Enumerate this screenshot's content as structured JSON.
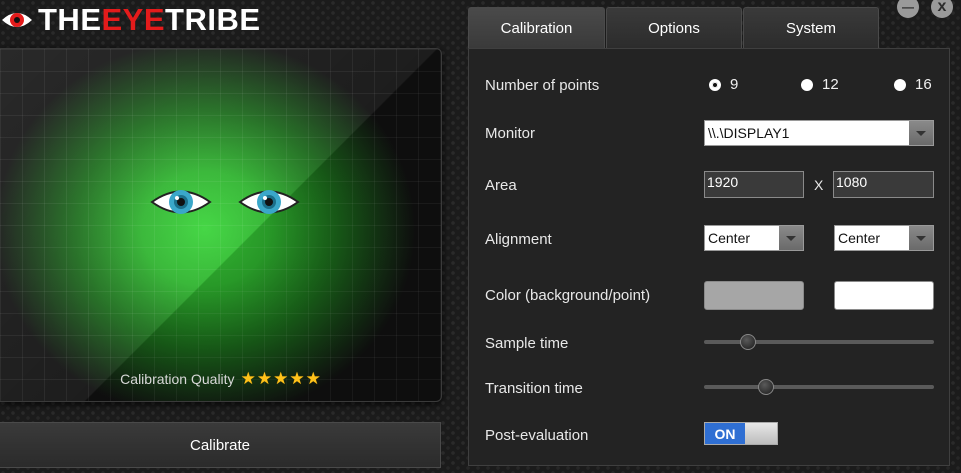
{
  "logo": {
    "text_white_1": "THE",
    "text_red": "EYE",
    "text_white_2": "TRIBE"
  },
  "window_controls": {
    "minimize": "—",
    "close": "x"
  },
  "preview": {
    "quality_label": "Calibration Quality",
    "quality_stars": 5,
    "star_glyph": "★"
  },
  "calibrate_button": "Calibrate",
  "tabs": [
    {
      "label": "Calibration",
      "active": true
    },
    {
      "label": "Options",
      "active": false
    },
    {
      "label": "System",
      "active": false
    }
  ],
  "settings": {
    "number_of_points": {
      "label": "Number of points",
      "options": [
        "9",
        "12",
        "16"
      ],
      "selected": "9"
    },
    "monitor": {
      "label": "Monitor",
      "value": "\\\\.\\DISPLAY1"
    },
    "area": {
      "label": "Area",
      "width": "1920",
      "separator": "X",
      "height": "1080"
    },
    "alignment": {
      "label": "Alignment",
      "horizontal": "Center",
      "vertical": "Center"
    },
    "color": {
      "label": "Color (background/point)",
      "background": "#a6a6a6",
      "point": "#ffffff"
    },
    "sample_time": {
      "label": "Sample time",
      "value_fraction": 0.19
    },
    "transition_time": {
      "label": "Transition time",
      "value_fraction": 0.27
    },
    "post_evaluation": {
      "label": "Post-evaluation",
      "state": "ON"
    }
  }
}
